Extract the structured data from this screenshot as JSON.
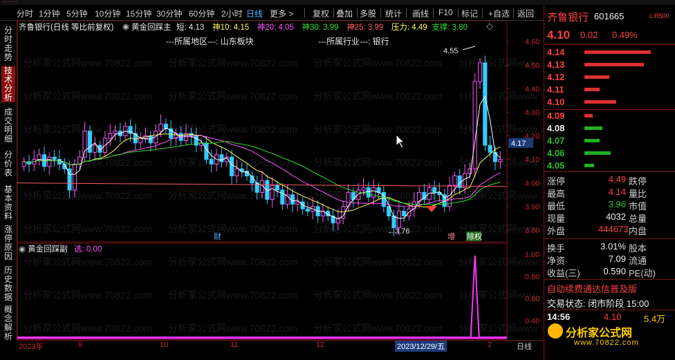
{
  "menu": {
    "periods": [
      "分时",
      "1分钟",
      "5分钟",
      "10分钟",
      "15分钟",
      "30分钟",
      "60分钟",
      "2小时",
      "日线",
      "更多 >"
    ],
    "active_period": "日线",
    "tools": [
      "复权",
      "叠加",
      "多股",
      "统计",
      "画线",
      "F10",
      "标记",
      "+自选",
      "返回"
    ]
  },
  "side_tabs": [
    {
      "label": "分时走势",
      "active": false
    },
    {
      "label": "技术分析",
      "active": true
    },
    {
      "label": "成交明细",
      "active": false
    },
    {
      "label": "分价表",
      "active": false
    },
    {
      "label": "基本资料",
      "active": false
    },
    {
      "label": "涨停原因",
      "active": false
    },
    {
      "label": "历史数据",
      "active": false
    },
    {
      "label": "概念解析",
      "active": false
    }
  ],
  "main_legend": {
    "title": "齐鲁银行(日线 等比前复权)",
    "indicator": "黄金回踩主",
    "items": [
      {
        "text": "短: 4.13",
        "color": "#e8e8e8"
      },
      {
        "text": "神10: 4.15",
        "color": "#ffff55"
      },
      {
        "text": "神20: 4.05",
        "color": "#ff55ff"
      },
      {
        "text": "神30: 3.99",
        "color": "#33dd33"
      },
      {
        "text": "神25: 3.99",
        "color": "#ff6060"
      },
      {
        "text": "压力: 4.49",
        "color": "#ffff55"
      },
      {
        "text": "支撑: 3.80",
        "color": "#33dd33"
      }
    ]
  },
  "region_text": "---所属地区---: 山东板块",
  "industry_text": "---所属行业---: 银行",
  "annotations": {
    "high": "4.55",
    "low": "3.76",
    "cai": "财",
    "zeng": "增",
    "jie": "除权"
  },
  "sub_legend": {
    "title": "黄金回踩副",
    "value": "选: 0.00"
  },
  "time_axis": {
    "labels": [
      {
        "t": "2023年",
        "l": 2
      },
      {
        "t": "9",
        "l": 88
      },
      {
        "t": "10",
        "l": 206
      },
      {
        "t": "11",
        "l": 308
      },
      {
        "t": "12",
        "l": 432
      },
      {
        "t": "2",
        "l": 680
      }
    ],
    "cursor": "2023/12/29/五",
    "right": "日线"
  },
  "stock": {
    "name": "齐鲁银行",
    "code": "601665",
    "tag": "L R500",
    "price": "4.10",
    "change": "0.02",
    "pct": "0.49%"
  },
  "order_book": [
    {
      "price": "4.14",
      "bar": 96,
      "side": "sell"
    },
    {
      "price": "4.13",
      "bar": 86,
      "side": "sell"
    },
    {
      "price": "4.12",
      "bar": 36,
      "side": "sell"
    },
    {
      "price": "4.11",
      "bar": 22,
      "side": "sell"
    },
    {
      "price": "4.10",
      "bar": 46,
      "side": "sell"
    },
    {
      "price": "4.09",
      "bar": 12,
      "side": "sell"
    },
    {
      "price": "4.08",
      "bar": 26,
      "side": "buy"
    },
    {
      "price": "4.07",
      "bar": 22,
      "side": "buy"
    },
    {
      "price": "4.06",
      "bar": 38,
      "side": "buy"
    },
    {
      "price": "4.05",
      "bar": 14,
      "side": "buy"
    }
  ],
  "stats": [
    {
      "l1": "涨停",
      "v1": "4.49",
      "c1": "red",
      "l2": "跌停"
    },
    {
      "l1": "最高",
      "v1": "4.14",
      "c1": "red",
      "l2": "量比"
    },
    {
      "l1": "最低",
      "v1": "3.96",
      "c1": "green",
      "l2": "市值"
    },
    {
      "l1": "现量",
      "v1": "4032",
      "c1": "white",
      "l2": "总量"
    },
    {
      "l1": "外盘",
      "v1": "444673",
      "c1": "red",
      "l2": "内盘"
    }
  ],
  "stats2": [
    {
      "l1": "换手",
      "v1": "3.01%",
      "l2": "股本"
    },
    {
      "l1": "净资",
      "v1": "7.09",
      "l2": "流通"
    },
    {
      "l1": "收益(三)",
      "v1": "0.590",
      "l2": "PE(动)"
    }
  ],
  "promo": "自动续费通达信普及版",
  "trade_state": "交易状态: 闭市阶段 15:00",
  "last_tick": {
    "time": "14:56",
    "price": "4.10",
    "vol": "5.4万"
  },
  "watermark_text": "分析家公式网",
  "watermark_url": "www.70822.com",
  "bg_watermark": "分析家公式网www.70822.com",
  "y_axis": [
    "4.60",
    "4.50",
    "4.40",
    "4.30",
    "4.20",
    "4.10",
    "4.00",
    "3.90",
    "3.80"
  ],
  "y_current": "4.17",
  "sub_axis": [
    "1.00",
    "0.80",
    "0.60",
    "0.40",
    "0.20"
  ],
  "chart_data": {
    "type": "candlestick",
    "price_axis": [
      3.75,
      4.63
    ],
    "closes": [
      4.09,
      4.08,
      4.1,
      4.12,
      4.07,
      4.11,
      4.1,
      4.08,
      4.06,
      3.97,
      4.08,
      4.11,
      4.22,
      4.13,
      4.16,
      4.13,
      4.19,
      4.21,
      4.22,
      4.2,
      4.24,
      4.21,
      4.17,
      4.19,
      4.2,
      4.17,
      4.22,
      4.25,
      4.23,
      4.19,
      4.21,
      4.18,
      4.21,
      4.2,
      4.16,
      4.17,
      4.1,
      4.08,
      4.12,
      4.09,
      4.11,
      4.03,
      4.06,
      4.05,
      4.03,
      4.0,
      3.96,
      4.01,
      3.93,
      3.99,
      3.97,
      3.91,
      3.95,
      3.91,
      3.92,
      3.89,
      3.88,
      3.9,
      3.86,
      3.88,
      3.86,
      3.83,
      3.85,
      3.9,
      3.96,
      3.93,
      3.97,
      3.98,
      3.94,
      3.98,
      3.96,
      3.9,
      3.86,
      3.81,
      3.88,
      3.86,
      3.89,
      3.92,
      3.96,
      3.93,
      3.98,
      3.96,
      3.95,
      3.9,
      3.99,
      4.03,
      3.98,
      4.04,
      4.06,
      4.43,
      4.51,
      4.16,
      4.13,
      4.09,
      4.1
    ],
    "signal_peak_index": 75
  }
}
